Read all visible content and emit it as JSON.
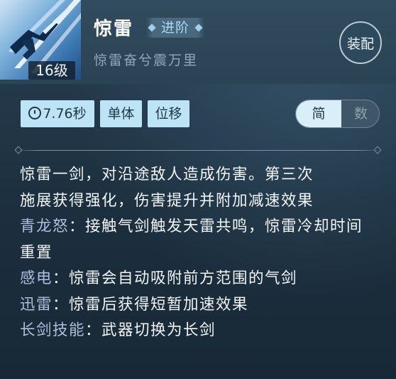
{
  "skill": {
    "name": "惊雷",
    "advance_label": "进阶",
    "subtitle": "惊雷奋兮震万里",
    "level": "16级",
    "icon": "lightning-sword-skill-icon"
  },
  "equip_button": "装配",
  "tags": {
    "cooldown": "7.76秒",
    "target": "单体",
    "movement": "位移"
  },
  "mode_toggle": {
    "active": "简",
    "inactive": "数"
  },
  "description": {
    "line1": "惊雷一剑，对沿途敌人造成伤害。第三次",
    "line2": "施展获得强化，伤害提升并附加减速效果",
    "effects": [
      {
        "name": "青龙怒",
        "text": "：接触气剑触发天雷共鸣，惊雷冷却时间重置"
      },
      {
        "name": "感电",
        "text": "：惊雷会自动吸附前方范围的气剑"
      },
      {
        "name": "迅雷",
        "text": "：惊雷后获得短暂加速效果"
      },
      {
        "name": "长剑技能",
        "text": "：武器切换为长剑"
      }
    ]
  },
  "colors": {
    "background": "#1c2f3e",
    "tag_bg": "#bde4f4",
    "effect_name": "#aebedd",
    "advance_text": "#a9d9f3"
  }
}
